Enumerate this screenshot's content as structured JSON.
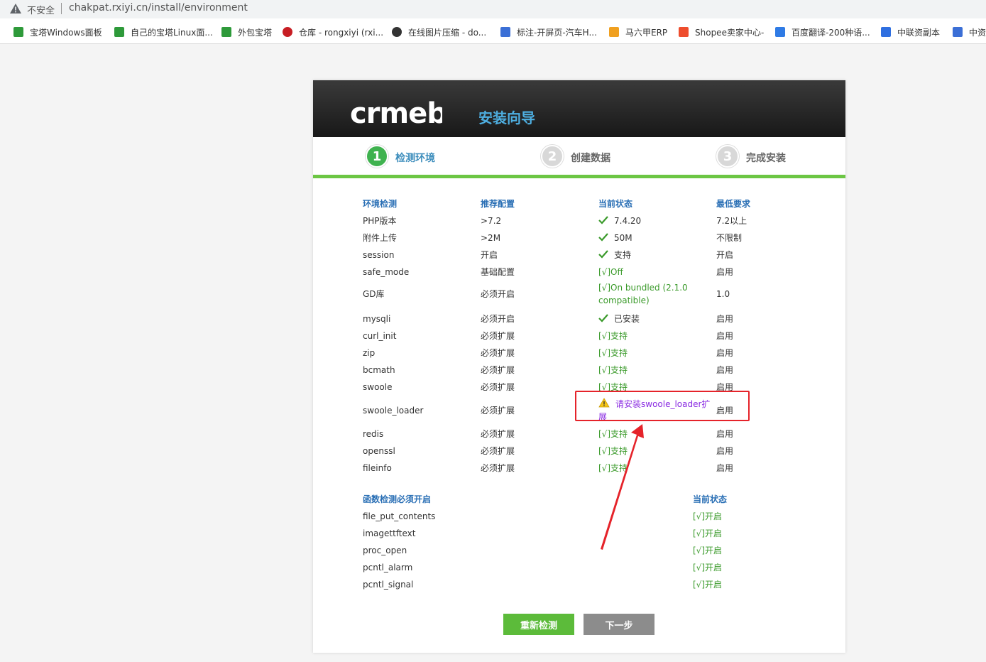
{
  "browser": {
    "security_label": "不安全",
    "url": "chakpat.rxiyi.cn/install/environment",
    "bookmarks": [
      {
        "label": "宝塔Windows面板",
        "icon": "shield-green-icon"
      },
      {
        "label": "自己的宝塔Linux面...",
        "icon": "shield-green-icon"
      },
      {
        "label": "外包宝塔",
        "icon": "shield-green-icon"
      },
      {
        "label": "仓库 - rongxiyi (rxi...",
        "icon": "gitee-icon"
      },
      {
        "label": "在线图片压缩 - do...",
        "icon": "circle-dark-icon"
      },
      {
        "label": "标注-开屏页-汽车H...",
        "icon": "figure-blue-icon"
      },
      {
        "label": "马六甲ERP",
        "icon": "orange-box-icon"
      },
      {
        "label": "Shopee卖家中心-",
        "icon": "shopee-icon"
      },
      {
        "label": "百度翻译-200种语...",
        "icon": "translate-icon"
      },
      {
        "label": "中联资副本",
        "icon": "doc-blue-icon"
      },
      {
        "label": "中资",
        "icon": "figure-blue-icon"
      }
    ]
  },
  "header": {
    "logo_text": "crmeb",
    "title": "安装向导"
  },
  "steps": [
    {
      "num": "1",
      "label": "检测环境",
      "active": true
    },
    {
      "num": "2",
      "label": "创建数据",
      "active": false
    },
    {
      "num": "3",
      "label": "完成安装",
      "active": false
    }
  ],
  "env_table": {
    "headers": [
      "环境检测",
      "推荐配置",
      "当前状态",
      "最低要求"
    ],
    "rows": [
      {
        "name": "PHP版本",
        "recommend": ">7.2",
        "status": "7.4.20",
        "status_style": "icon-ok",
        "min": "7.2以上"
      },
      {
        "name": "附件上传",
        "recommend": ">2M",
        "status": "50M",
        "status_style": "icon-ok",
        "min": "不限制"
      },
      {
        "name": "session",
        "recommend": "开启",
        "status": "支持",
        "status_style": "icon-ok",
        "min": "开启"
      },
      {
        "name": "safe_mode",
        "recommend": "基础配置",
        "status": "[√]Off",
        "status_style": "text-ok",
        "min": "启用"
      },
      {
        "name": "GD库",
        "recommend": "必须开启",
        "status": "[√]On bundled (2.1.0 compatible)",
        "status_style": "text-ok-multi",
        "min": "1.0"
      },
      {
        "name": "mysqli",
        "recommend": "必须开启",
        "status": "已安装",
        "status_style": "icon-ok",
        "min": "启用"
      },
      {
        "name": "curl_init",
        "recommend": "必须扩展",
        "status": "[√]支持",
        "status_style": "text-ok",
        "min": "启用"
      },
      {
        "name": "zip",
        "recommend": "必须扩展",
        "status": "[√]支持",
        "status_style": "text-ok",
        "min": "启用"
      },
      {
        "name": "bcmath",
        "recommend": "必须扩展",
        "status": "[√]支持",
        "status_style": "text-ok",
        "min": "启用"
      },
      {
        "name": "swoole",
        "recommend": "必须扩展",
        "status": "[√]支持",
        "status_style": "text-ok",
        "min": "启用"
      },
      {
        "name": "swoole_loader",
        "recommend": "必须扩展",
        "status": "请安装swoole_loader扩展",
        "status_style": "warning",
        "min": "启用"
      },
      {
        "name": "redis",
        "recommend": "必须扩展",
        "status": "[√]支持",
        "status_style": "text-ok",
        "min": "启用"
      },
      {
        "name": "openssl",
        "recommend": "必须扩展",
        "status": "[√]支持",
        "status_style": "text-ok",
        "min": "启用"
      },
      {
        "name": "fileinfo",
        "recommend": "必须扩展",
        "status": "[√]支持",
        "status_style": "text-ok",
        "min": "启用"
      }
    ]
  },
  "func_table": {
    "headers": [
      "函数检测必须开启",
      "当前状态"
    ],
    "rows": [
      {
        "name": "file_put_contents",
        "status": "[√]开启"
      },
      {
        "name": "imagettftext",
        "status": "[√]开启"
      },
      {
        "name": "proc_open",
        "status": "[√]开启"
      },
      {
        "name": "pcntl_alarm",
        "status": "[√]开启"
      },
      {
        "name": "pcntl_signal",
        "status": "[√]开启"
      }
    ]
  },
  "buttons": {
    "recheck": "重新检测",
    "next": "下一步"
  },
  "colors": {
    "accent_blue": "#2a6fb5",
    "ok_green": "#3a9a2a",
    "warning_purple": "#8a2be2",
    "annotation_red": "#e5232a",
    "button_green": "#5cbb3a",
    "button_gray": "#8c8c8c"
  }
}
